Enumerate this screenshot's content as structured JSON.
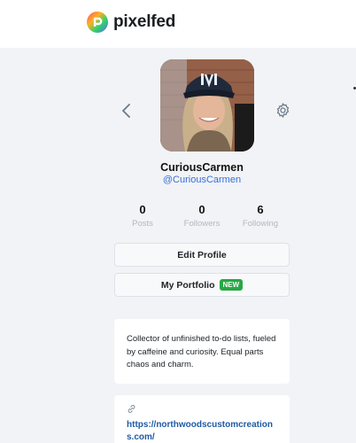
{
  "header": {
    "brand": "pixelfed"
  },
  "profile": {
    "display_name": "CuriousCarmen",
    "username": "@CuriousCarmen"
  },
  "stats": [
    {
      "value": "0",
      "label": "Posts"
    },
    {
      "value": "0",
      "label": "Followers"
    },
    {
      "value": "6",
      "label": "Following"
    }
  ],
  "actions": {
    "edit_profile": "Edit Profile",
    "portfolio": "My Portfolio",
    "portfolio_badge": "NEW"
  },
  "bio": "Collector of unfinished to-do lists, fueled by caffeine and curiosity. Equal parts chaos and charm.",
  "website": "https://northwoodscustomcreations.com/",
  "icons": [
    "pixelfed-logo-icon",
    "back-chevron-icon",
    "gear-icon",
    "link-icon"
  ],
  "colors": {
    "accent": "#3a6fd8",
    "badge": "#28a745",
    "link": "#1f5aa6"
  }
}
